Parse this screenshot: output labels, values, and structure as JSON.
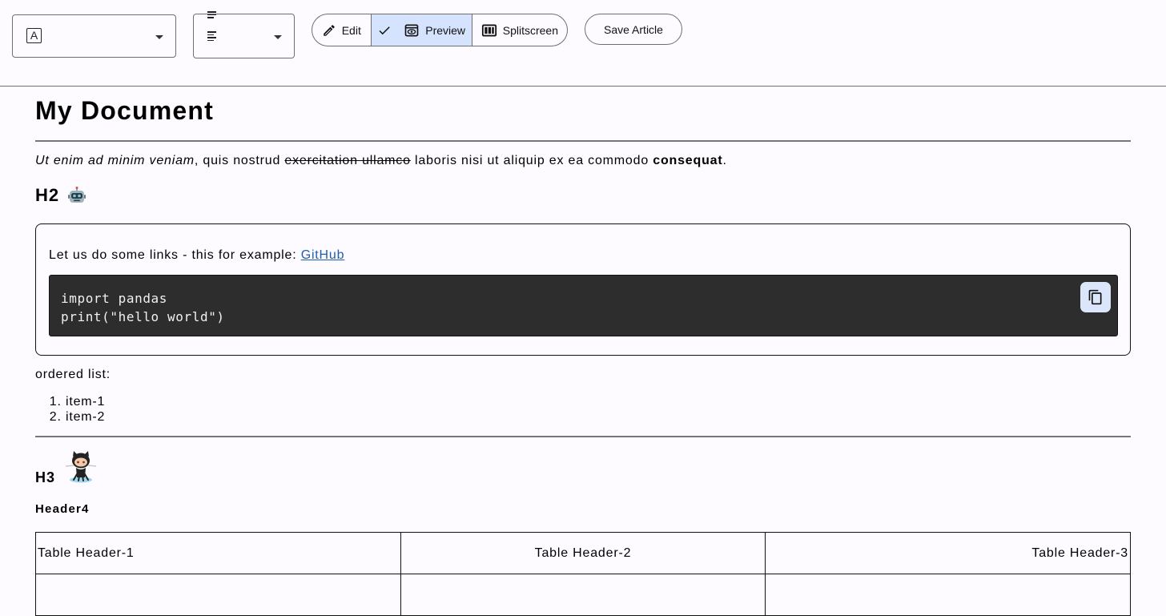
{
  "toolbar": {
    "font_select_glyph": "A",
    "edit_label": "Edit",
    "preview_label": "Preview",
    "splitscreen_label": "Splitscreen",
    "save_label": "Save Article",
    "active_mode": "Preview",
    "active_color": "#d6e3ff"
  },
  "document": {
    "title": "My Document",
    "paragraph": {
      "italic": "Ut enim ad minim veniam",
      "plain1": ", quis nostrud ",
      "strike": "exercitation ullamco",
      "plain2": " laboris nisi ut aliquip ex ea commodo ",
      "bold": "consequat",
      "end": "."
    },
    "h2": "H2",
    "h2_emoji": "robot-icon",
    "callout": {
      "text": "Let us do some links - this for example: ",
      "link": "GitHub",
      "link_color": "#1f5fa8"
    },
    "code": {
      "lines": [
        "import pandas",
        "print(\"hello world\")"
      ],
      "background": "#2d2d2d"
    },
    "list_intro": "ordered list:",
    "list_items": [
      "item-1",
      "item-2"
    ],
    "h3": "H3",
    "h3_image": "octocat-icon",
    "h4": "Header4",
    "table": {
      "headers": [
        "Table Header-1",
        "Table Header-2",
        "Table Header-3"
      ],
      "alignments": [
        "left",
        "center",
        "right"
      ]
    }
  }
}
